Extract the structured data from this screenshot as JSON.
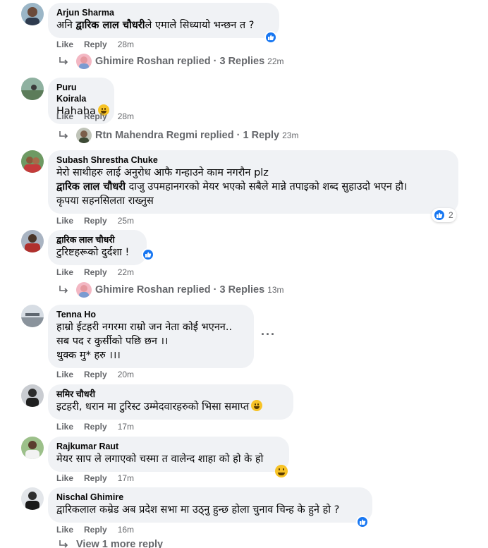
{
  "comments": [
    {
      "author": "Arjun Sharma",
      "text_bold": "द्वारिक लाल चौधरी",
      "text_pre": "अनि ",
      "text_post": "ले एमाले सिध्यायो भन्छन त ?",
      "like": "Like",
      "reply": "Reply",
      "time": "28m",
      "reply_summary": {
        "name": "Ghimire Roshan replied",
        "sep": "·",
        "count": "3 Replies",
        "time": "22m"
      }
    },
    {
      "author": "Puru Koirala",
      "text": "Hahaha",
      "like": "Like",
      "reply": "Reply",
      "time": "28m",
      "reply_summary": {
        "name": "Rtn Mahendra Regmi replied",
        "sep": "·",
        "count": "1 Reply",
        "time": "23m"
      }
    },
    {
      "author": "Subash Shrestha Chuke",
      "line1": "मेरो साथीहरु लाई अनुरोध आफै गन्हाउने काम नगरौन plz",
      "line2_bold": "द्वारिक लाल चौधरी",
      "line2_rest": " दाजु उपमहानगरको मेयर भएको सबैले मान्ने तपाइको शब्द सुहाउदो भएन हौ।",
      "line3": "कृपया सहनसिलता राख्नुस",
      "like": "Like",
      "reply": "Reply",
      "time": "25m",
      "reactions": "2"
    },
    {
      "author": "द्वारिक लाल चौधरी",
      "text": "टुरिष्टहरूको दुर्दशा !",
      "like": "Like",
      "reply": "Reply",
      "time": "22m",
      "reply_summary": {
        "name": "Ghimire Roshan replied",
        "sep": "·",
        "count": "3 Replies",
        "time": "13m"
      }
    },
    {
      "author": "Tenna Ho",
      "line1": "हाम्रो ईटहरी नगरमा राम्रो जन नेता कोई भएनन..",
      "line2": "सब पद र कुर्सीको पछि छन ।।",
      "line3": "थुक्क मु* हरु ।।।",
      "like": "Like",
      "reply": "Reply",
      "time": "20m"
    },
    {
      "author": "समिर चौधरी",
      "text": "इटहरी, धरान मा टुरिस्ट उम्मेदवारहरुको भिसा समाप्त",
      "like": "Like",
      "reply": "Reply",
      "time": "17m"
    },
    {
      "author": "Rajkumar Raut",
      "text": "मेयर साप ले लगाएको चस्मा त वालेन्द शाहा को हो के हो",
      "like": "Like",
      "reply": "Reply",
      "time": "17m"
    },
    {
      "author": "Nischal Ghimire",
      "text": "द्वारिकलाल कम्रेड अब प्रदेश सभा मा उठ्नु हुन्छ होला चुनाव चिन्ह के हुने हो ?",
      "like": "Like",
      "reply": "Reply",
      "time": "16m"
    }
  ],
  "view_more": "View 1 more reply",
  "more_options": "···",
  "colors": {
    "bubble": "#f0f2f5",
    "meta": "#65676b",
    "like_blue": "#1877f2"
  }
}
